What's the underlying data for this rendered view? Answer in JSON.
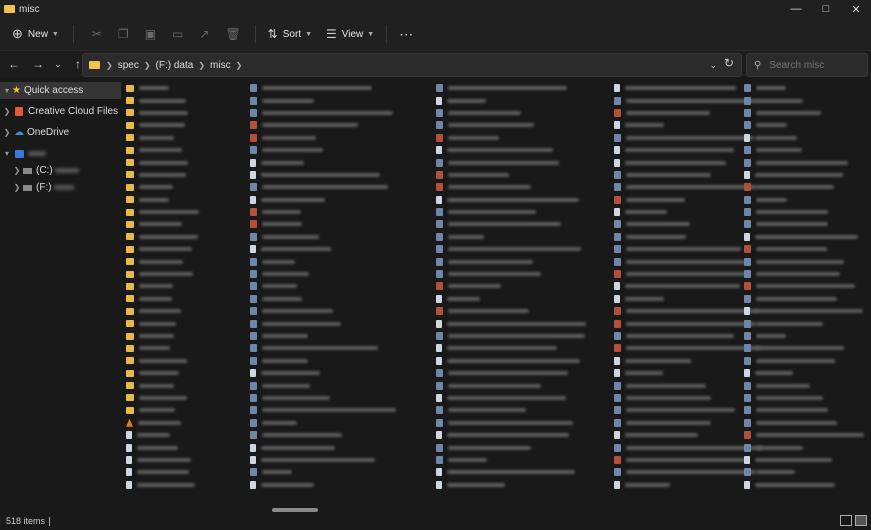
{
  "window": {
    "title": "misc"
  },
  "toolbar": {
    "new_label": "New",
    "sort_label": "Sort",
    "view_label": "View"
  },
  "address": {
    "crumbs": [
      "spec",
      "(F:) data",
      "misc"
    ]
  },
  "search": {
    "placeholder": "Search misc"
  },
  "sidebar": {
    "quick_access": "Quick access",
    "creative_cloud": "Creative Cloud Files",
    "onedrive": "OneDrive",
    "drive_c": "(C:)",
    "drive_f": "(F:)"
  },
  "status": {
    "item_count": "518 items"
  },
  "colors": {
    "folder": "#e8b84a",
    "accent": "#f2c14e",
    "background": "#191919"
  }
}
